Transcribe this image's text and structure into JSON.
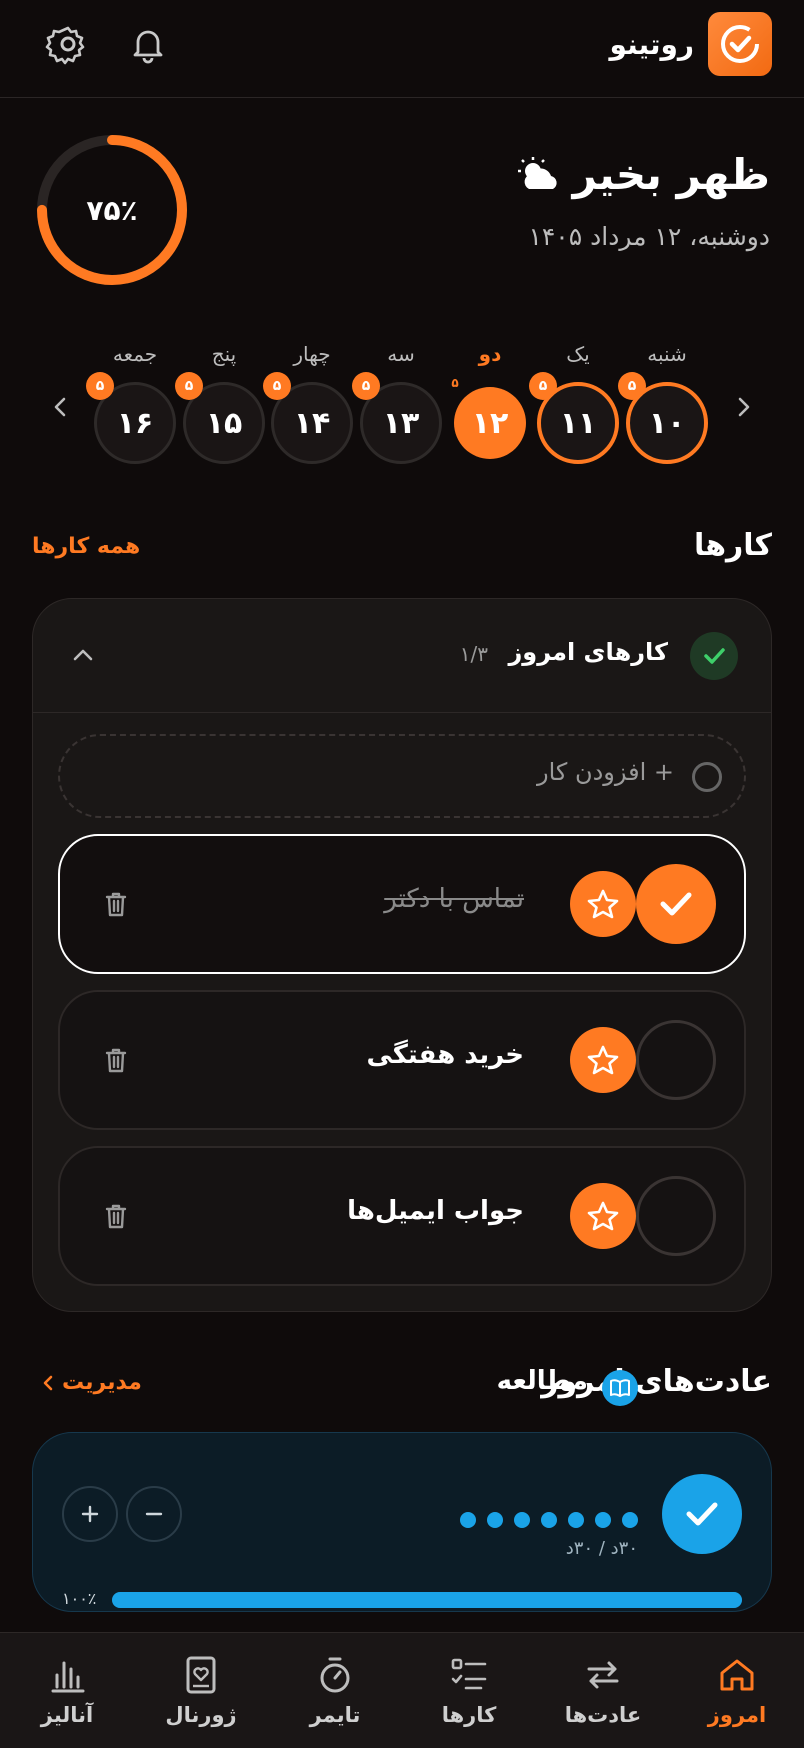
{
  "header": {
    "app_title": "روتینو",
    "settings_icon": "gear-icon",
    "notifications_icon": "bell-icon",
    "logo_icon": "check-loop-icon"
  },
  "greeting": {
    "title": "ظهر بخیر",
    "weather_icon": "sun-cloud-icon",
    "date": "دوشنبه، ۱۲ مرداد ۱۴۰۵",
    "progress_label": "۷۵٪",
    "progress_value": 0.75
  },
  "week": {
    "days": [
      {
        "name": "شنبه",
        "date": "۱۰",
        "badge": "۵",
        "state": "marked"
      },
      {
        "name": "یک",
        "date": "۱۱",
        "badge": "۵",
        "state": "marked"
      },
      {
        "name": "دو",
        "date": "۱۲",
        "badge": "۵",
        "state": "selected"
      },
      {
        "name": "سه",
        "date": "۱۳",
        "badge": "۵",
        "state": "normal"
      },
      {
        "name": "چهار",
        "date": "۱۴",
        "badge": "۵",
        "state": "normal"
      },
      {
        "name": "پنج",
        "date": "۱۵",
        "badge": "۵",
        "state": "normal"
      },
      {
        "name": "جمعه",
        "date": "۱۶",
        "badge": "۵",
        "state": "normal"
      }
    ]
  },
  "tasks_section": {
    "title": "کارها",
    "link": "همه کارها",
    "card_title": "کارهای امروز",
    "count": "۱/۳",
    "add_placeholder": "+ افزودن کار",
    "items": [
      {
        "text": "تماس با دکتر",
        "done": true
      },
      {
        "text": "خرید هفتگی",
        "done": false
      },
      {
        "text": "جواب ایمیل‌ها",
        "done": false
      }
    ]
  },
  "habits_section": {
    "title": "عادت‌های امروز",
    "link": "مدیریت",
    "habit": {
      "name": "مطالعه",
      "icon": "book-icon",
      "meta": "۳۰د / ۳۰د",
      "progress_label": "۱۰۰٪",
      "progress_value": 1.0,
      "dots_filled": 7,
      "dots_total": 7
    }
  },
  "nav": [
    {
      "label": "امروز",
      "icon": "home-icon",
      "active": true
    },
    {
      "label": "عادت‌ها",
      "icon": "repeat-icon",
      "active": false
    },
    {
      "label": "کارها",
      "icon": "checklist-icon",
      "active": false
    },
    {
      "label": "تایمر",
      "icon": "stopwatch-icon",
      "active": false
    },
    {
      "label": "ژورنال",
      "icon": "journal-icon",
      "active": false
    },
    {
      "label": "آنالیز",
      "icon": "chart-icon",
      "active": false
    }
  ],
  "colors": {
    "accent": "#ff7a22",
    "habit_accent": "#1aa3e8",
    "background": "#0f0b0b"
  }
}
